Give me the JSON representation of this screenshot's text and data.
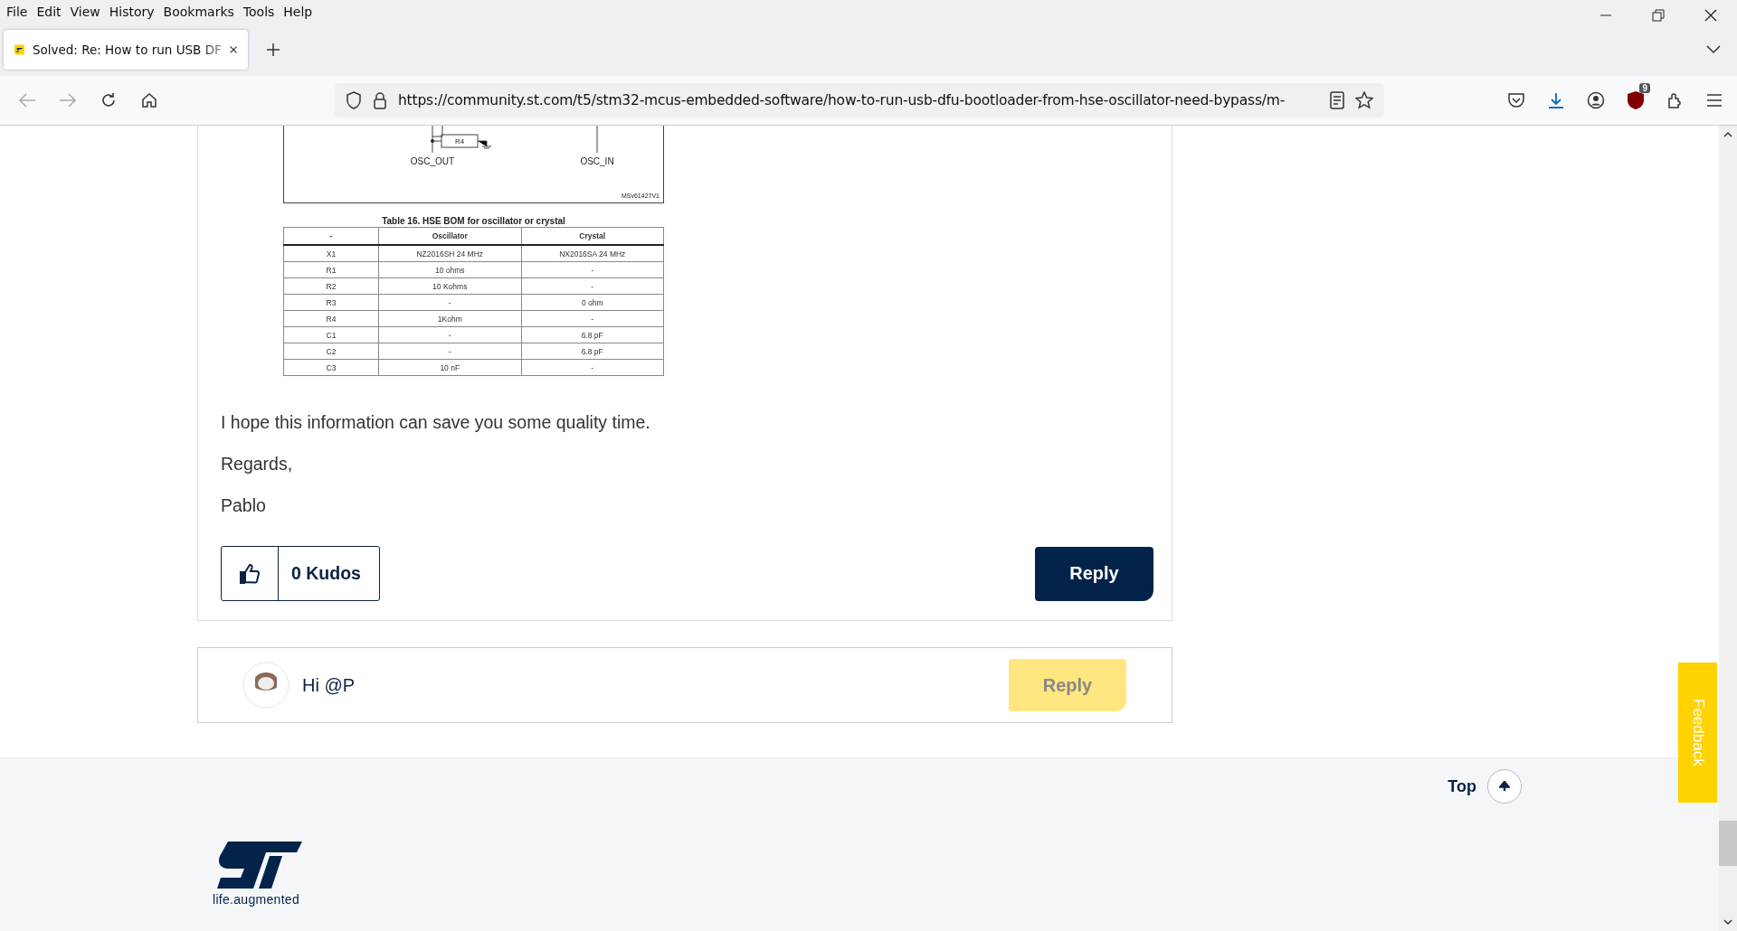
{
  "menu_bar": [
    "File",
    "Edit",
    "View",
    "History",
    "Bookmarks",
    "Tools",
    "Help"
  ],
  "tabs": [
    {
      "title": "Solved: Re: How to run USB DF",
      "selected": true
    }
  ],
  "address_bar": {
    "url": "https://community.st.com/t5/stm32-mcus-embedded-software/how-to-run-usb-dfu-bootloader-from-hse-oscillator-need-bypass/m-"
  },
  "extension_badge": "9",
  "post": {
    "figure": {
      "resistor": "R4",
      "labels": [
        "OSC_OUT",
        "OSC_IN"
      ],
      "figure_id": "MSv61427V1"
    },
    "table": {
      "caption": "Table 16. HSE BOM for oscillator or crystal",
      "columns": [
        "-",
        "Oscillator",
        "Crystal"
      ],
      "rows": [
        [
          "X1",
          "NZ2016SH 24 MHz",
          "NX2016SA 24 MHz"
        ],
        [
          "R1",
          "10 ohms",
          "-"
        ],
        [
          "R2",
          "10 Kohms",
          "-"
        ],
        [
          "R3",
          "-",
          "0 ohm"
        ],
        [
          "R4",
          "1Kohm",
          "-"
        ],
        [
          "C1",
          "-",
          "6.8 pF"
        ],
        [
          "C2",
          "-",
          "6.8 pF"
        ],
        [
          "C3",
          "10 nF",
          "-"
        ]
      ]
    },
    "paragraphs": [
      "I hope this information can save you some quality time.",
      "Regards,",
      "Pablo"
    ],
    "kudos": "0 Kudos",
    "reply": "Reply"
  },
  "reply_preview": {
    "text": "Hi @P",
    "reply": "Reply"
  },
  "footer": {
    "top": "Top",
    "tagline": "life.augmented"
  },
  "feedback": "Feedback"
}
